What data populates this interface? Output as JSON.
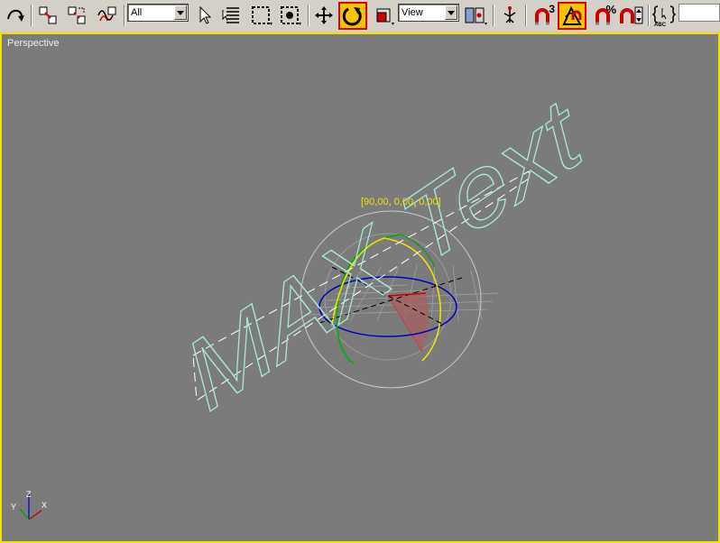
{
  "toolbar": {
    "selection_filter": "All",
    "ref_coord_system": "View",
    "named_selection": "",
    "snap_toggle_label": "3",
    "percent_snap_label": "%",
    "abc_label": "ABC",
    "buttons": [
      {
        "name": "undo",
        "icon": "curved-arrow-icon"
      },
      {
        "name": "select-and-link",
        "icon": "link-icon"
      },
      {
        "name": "unlink-selection",
        "icon": "unlink-icon"
      },
      {
        "name": "bind-to-space-warp",
        "icon": "space-warp-icon"
      },
      {
        "name": "select-object",
        "icon": "arrow-cursor-icon"
      },
      {
        "name": "select-by-name",
        "icon": "list-icon"
      },
      {
        "name": "rectangular-selection",
        "icon": "dashed-rect-icon"
      },
      {
        "name": "window-crossing",
        "icon": "window-crossing-icon"
      },
      {
        "name": "select-and-move",
        "icon": "move-icon"
      },
      {
        "name": "select-and-rotate",
        "icon": "rotate-icon",
        "active": true
      },
      {
        "name": "select-and-scale",
        "icon": "scale-icon"
      },
      {
        "name": "use-pivot-point-center",
        "icon": "pivot-icon"
      },
      {
        "name": "select-and-manipulate",
        "icon": "manipulate-icon"
      },
      {
        "name": "snaps-toggle",
        "icon": "magnet-3-icon"
      },
      {
        "name": "angle-snap-toggle",
        "icon": "angle-snap-icon",
        "active": true
      },
      {
        "name": "percent-snap",
        "icon": "magnet-percent-icon"
      },
      {
        "name": "spinner-snap",
        "icon": "magnet-spinner-icon"
      },
      {
        "name": "edit-named-selection",
        "icon": "named-selection-icon"
      }
    ]
  },
  "viewport": {
    "label": "Perspective",
    "gizmo_readout": "[90,00, 0,00, 0,00]",
    "text_object": "MAX Text",
    "axis_labels": {
      "x": "X",
      "y": "Y",
      "z": "Z"
    }
  },
  "colors": {
    "viewport_bg": "#7b7b7b",
    "active_border": "#f0e000",
    "spline_text": "#a8e8d0",
    "gizmo_x": "#e00000",
    "gizmo_y": "#00b000",
    "gizmo_z": "#0000c0",
    "gizmo_active": "#f0e000"
  }
}
